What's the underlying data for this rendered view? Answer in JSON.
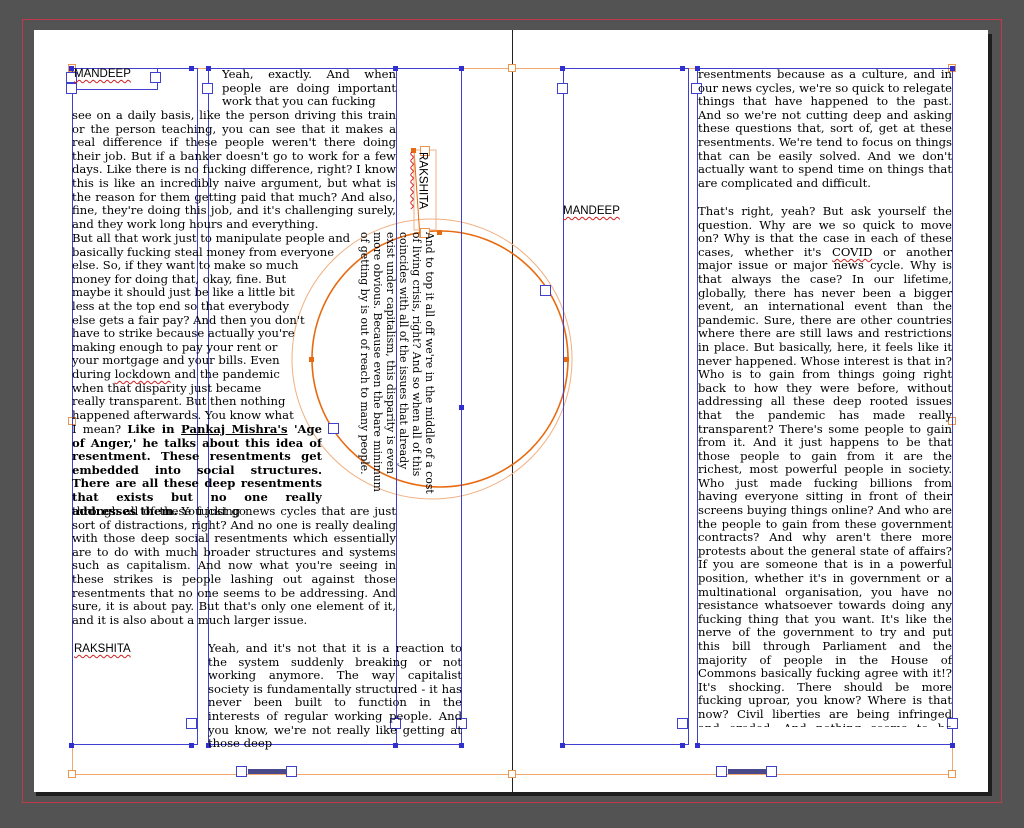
{
  "spread": {
    "left_page": {
      "speaker_top": "MANDEEP",
      "col1_top": "Yeah, exactly. And when people are doing important work that you can fucking",
      "col1_main": "see on a daily basis, like the person driving this train or the person teaching, you can see that it makes a real difference if these people weren't there doing their job. But if a banker doesn't go to work for a few days. Like there is no fucking difference, right? I know this is like an incredibly naive argument, but what is the reason for them getting paid that much? And also, fine, they're doing this job, and it's challenging surely, and they work long hours and everything.",
      "wrap_lines": [
        "But all that work just to manipulate people and",
        "basically fucking steal money from everyone",
        "else. So, if they want to make so much",
        "money for doing that, okay, fine. But",
        "maybe it should just be like a little bit",
        "less at the top end so that everybody",
        "else gets a fair pay? And then you don't",
        "have to strike because actually you're",
        "making enough to pay your rent or",
        "your mortgage and your bills. Even",
        "during lockdown and the pandemic",
        "when that disparity just became",
        "really transparent. But then nothing",
        "happened afterwards. You know what"
      ],
      "highlight_word": "lockdown",
      "quote_intro": "I mean? ",
      "quote_bold_1": "Like in ",
      "quote_name": "Pankaj Mishra's",
      "quote_bold_2": " 'Age of Anger,' he talks about this idea of resentment. These resentments get embedded into social structures. There are all these deep resentments that exists but no one really addresses them.",
      "quote_tail": " You just go",
      "col1_rest": "through all of these fucking news cycles that are just sort of distractions, right? And no one is really dealing with those deep social resentments which essentially are to do with much broader structures and systems such as capitalism. And now what you're seeing in these strikes is people lashing out against those resentments that no one seems to be addressing. And sure, it is about pay. But that's only one element of it, and it is also about a much larger issue.",
      "speaker_mid": "RAKSHITA",
      "col2_bottom": "Yeah, and it's not that it is a reaction to the system suddenly breaking or not working anymore. The way capitalist society is fundamentally structured - it has never been built to function in the interests of regular working people. And you know, we're not really like getting at those deep",
      "vertical_label": "RAKSHITA",
      "vertical_text": "And to top it all off we're in the middle of a cost of living crisis, right? And so when all of this coincides with all of the issues that already exist under capitalism, this disparity is even more obvious. Because even the bare minimum of getting by is out of reach to many people."
    },
    "right_page": {
      "col_top": "resentments because as a culture, and in our news cycles, we're so quick to relegate things that have happened to the past. And so we're not cutting deep and asking these questions that, sort of, get at these resentments. We're tend to focus on things that can be easily solved. And we don't actually want to spend time on things that are complicated and difficult.",
      "speaker": "MANDEEP",
      "col_main_1": "That's right, yeah? But ask yourself the question. Why are we so quick to move on? Why is that the case in each of these cases, whether it's ",
      "covid": "COVID",
      "col_main_2": " or another major issue or major news cycle. Why is that always the case? In our lifetime, globally, there has never been a bigger event, an international event than the pandemic. Sure, there are other countries where there are still laws and restrictions in place. But basically, here, it feels like it never happened. Whose interest is that in? Who is to gain from things going right back to how they were before, without addressing all these deep rooted issues that the pandemic has made really transparent? There's some people to gain from it. And it just happens to be that those people to gain from it are the richest, most powerful people in society. Who just made fucking billions from having everyone sitting in front of their screens buying things online? And who are the people to gain from these government contracts? And why aren't there more protests about the general state of affairs? If you are someone that is in a powerful position, whether it's in government or a multinational organisation, you have no resistance whatsoever towards doing any fucking thing that you want. It's like the nerve of the government to try and put this bill through Parliament and the majority of people in the House of Commons basically fucking agree with it!? It's shocking. There should be more fucking uproar, you know? Where is that now? Civil liberties are being infringed and eroded. And nothing seems to be happening to stop it."
    }
  },
  "colors": {
    "pasteboard": "#535353",
    "frame_selected": "#4040d0",
    "guide": "#f0a870",
    "spell_squiggle": "#d02020"
  }
}
